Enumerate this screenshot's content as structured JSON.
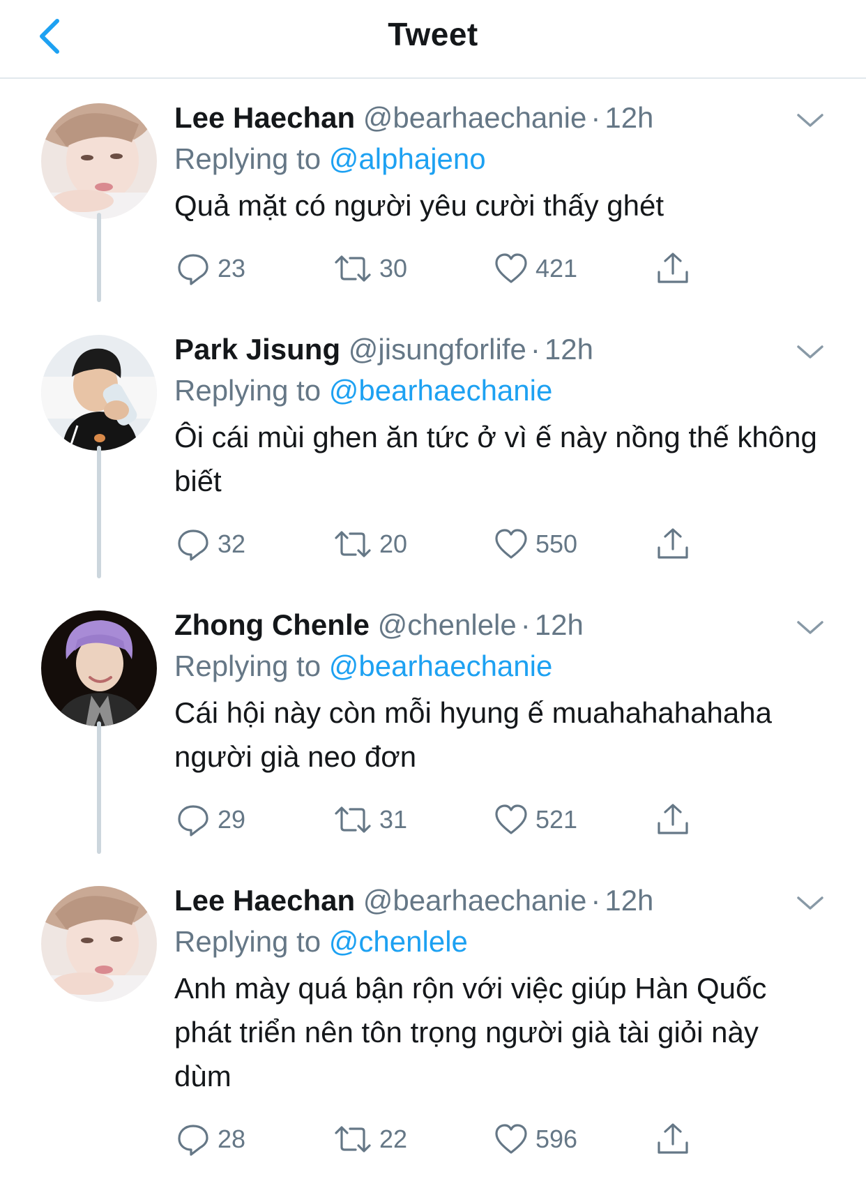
{
  "header": {
    "title": "Tweet",
    "back_icon": "chevron-left-icon",
    "accent": "#1da1f2"
  },
  "colors": {
    "accent": "#1da1f2",
    "secondary_text": "#657786",
    "primary_text": "#14171a",
    "thread_line": "#ccd6dd"
  },
  "tweets": [
    {
      "name": "Lee Haechan",
      "handle": "@bearhaechanie",
      "dot": "·",
      "time": "12h",
      "replying_prefix": "Replying to",
      "replying_to": "@alphajeno",
      "text": "Quả mặt có người yêu cười thấy ghét",
      "replies": "23",
      "retweets": "30",
      "likes": "421"
    },
    {
      "name": "Park Jisung",
      "handle": "@jisungforlife",
      "dot": "·",
      "time": "12h",
      "replying_prefix": "Replying to",
      "replying_to": "@bearhaechanie",
      "text": "Ôi cái mùi ghen ăn tức ở vì ế này nồng thế không biết",
      "replies": "32",
      "retweets": "20",
      "likes": "550"
    },
    {
      "name": "Zhong Chenle",
      "handle": "@chenlele",
      "dot": "·",
      "time": "12h",
      "replying_prefix": "Replying to",
      "replying_to": "@bearhaechanie",
      "text": "Cái hội này còn mỗi hyung ế muahahahahaha người già neo đơn",
      "replies": "29",
      "retweets": "31",
      "likes": "521"
    },
    {
      "name": "Lee Haechan",
      "handle": "@bearhaechanie",
      "dot": "·",
      "time": "12h",
      "replying_prefix": "Replying to",
      "replying_to": "@chenlele",
      "text": "Anh mày quá bận rộn với việc giúp Hàn Quốc phát triển nên tôn trọng người già tài giỏi này dùm",
      "replies": "28",
      "retweets": "22",
      "likes": "596"
    }
  ]
}
